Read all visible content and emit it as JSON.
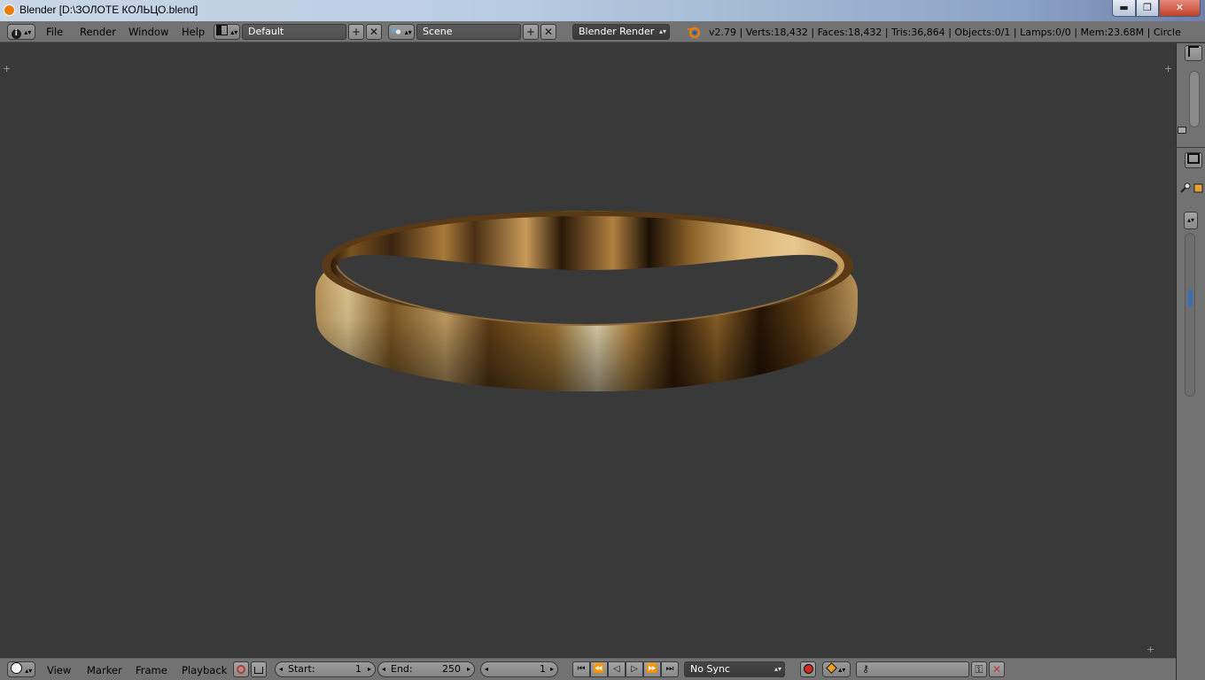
{
  "window": {
    "title": "Blender  [D:\\ЗОЛОТЕ КОЛЬЦО.blend]",
    "min_glyph": "▬",
    "max_glyph": "❐",
    "close_glyph": "✕"
  },
  "header": {
    "menus": [
      "File",
      "Render",
      "Window",
      "Help"
    ],
    "layout_name": "Default",
    "scene_name": "Scene",
    "render_engine": "Blender Render",
    "stats": "v2.79 | Verts:18,432 | Faces:18,432 | Tris:36,864 | Objects:0/1 | Lamps:0/0 | Mem:23.68M | Circle",
    "add_glyph": "+",
    "remove_glyph": "✕",
    "dropdown_glyph": "▴▾",
    "info_glyph": "i"
  },
  "viewport": {
    "object": "Circle",
    "material": "gold",
    "background_color": "#393939",
    "corner_glyph": "+"
  },
  "timeline": {
    "menus": [
      "View",
      "Marker",
      "Frame",
      "Playback"
    ],
    "start_label": "Start:",
    "start_value": "1",
    "end_label": "End:",
    "end_value": "250",
    "current_frame": "1",
    "sync_mode": "No Sync",
    "left_arrow": "◂",
    "right_arrow": "▸"
  },
  "colors": {
    "header_bg": "#727272",
    "viewport_bg": "#393939",
    "accent_orange": "#e87d0d",
    "record_red": "#d0291f"
  }
}
